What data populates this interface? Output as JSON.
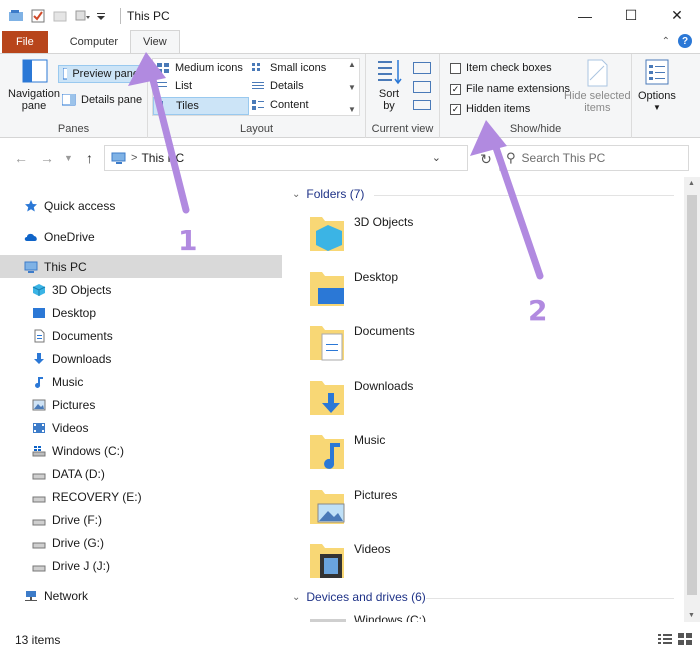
{
  "window": {
    "title": "This PC"
  },
  "tabs": {
    "file": "File",
    "computer": "Computer",
    "view": "View"
  },
  "ribbon": {
    "panes": {
      "label": "Panes",
      "navigation_pane": "Navigation\npane",
      "preview_pane": "Preview pane",
      "details_pane": "Details pane"
    },
    "layout": {
      "label": "Layout",
      "medium_icons": "Medium icons",
      "small_icons": "Small icons",
      "list": "List",
      "details": "Details",
      "tiles": "Tiles",
      "content": "Content"
    },
    "current_view": {
      "label": "Current view",
      "sort_by": "Sort\nby"
    },
    "show_hide": {
      "label": "Show/hide",
      "item_check_boxes": "Item check boxes",
      "file_name_extensions": "File name extensions",
      "hidden_items": "Hidden items",
      "hide_selected_items": "Hide selected\nitems"
    },
    "options": "Options"
  },
  "address": {
    "path": "This PC",
    "search_placeholder": "Search This PC"
  },
  "sidebar": {
    "items": [
      {
        "label": "Quick access",
        "icon": "star-icon"
      },
      {
        "label": "OneDrive",
        "icon": "cloud-icon"
      },
      {
        "label": "This PC",
        "icon": "computer-icon"
      },
      {
        "label": "3D Objects",
        "icon": "cube-icon"
      },
      {
        "label": "Desktop",
        "icon": "desktop-icon"
      },
      {
        "label": "Documents",
        "icon": "document-icon"
      },
      {
        "label": "Downloads",
        "icon": "download-icon"
      },
      {
        "label": "Music",
        "icon": "music-icon"
      },
      {
        "label": "Pictures",
        "icon": "picture-icon"
      },
      {
        "label": "Videos",
        "icon": "video-icon"
      },
      {
        "label": "Windows (C:)",
        "icon": "windows-drive-icon"
      },
      {
        "label": "DATA (D:)",
        "icon": "drive-icon"
      },
      {
        "label": "RECOVERY (E:)",
        "icon": "drive-icon"
      },
      {
        "label": "Drive (F:)",
        "icon": "drive-icon"
      },
      {
        "label": "Drive (G:)",
        "icon": "drive-icon"
      },
      {
        "label": "Drive J (J:)",
        "icon": "drive-icon"
      },
      {
        "label": "Network",
        "icon": "network-icon"
      }
    ]
  },
  "content": {
    "folders_header": "Folders (7)",
    "folders": [
      "3D Objects",
      "Desktop",
      "Documents",
      "Downloads",
      "Music",
      "Pictures",
      "Videos"
    ],
    "devices_header": "Devices and drives (6)",
    "devices": [
      "Windows (C:)"
    ]
  },
  "status": {
    "items": "13 items"
  },
  "annotations": {
    "one": "1",
    "two": "2"
  },
  "colors": {
    "file_tab": "#b8451b",
    "accent": "#2b78d6",
    "selection": "#cce4f7",
    "annotation": "#b18ae0"
  }
}
